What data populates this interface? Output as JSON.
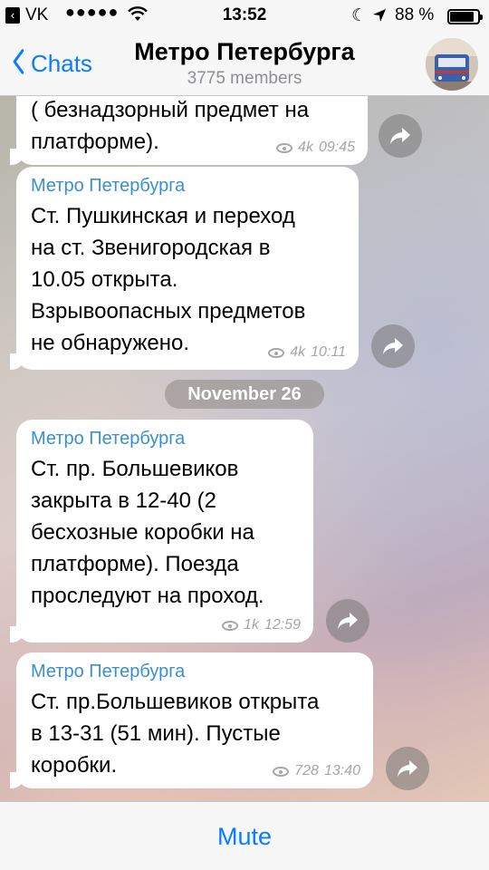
{
  "status_bar": {
    "carrier": "VK",
    "signal": "●●●●●",
    "time": "13:52",
    "battery_percent": "88 %",
    "battery_level": 0.88
  },
  "nav": {
    "back_label": "Chats",
    "title": "Метро Петербурга",
    "subtitle": "3775 members",
    "accent_color": "#0a7cff"
  },
  "messages": [
    {
      "author": "",
      "text": "( безнадзорный предмет на\nплатформе).",
      "views": "4k",
      "time": "09:45"
    },
    {
      "author": "Метро Петербурга",
      "text": "Ст. Пушкинская и переход\nна ст. Звенигородская в\n10.05 открыта.\nВзрывоопасных предметов\nне обнаружено.",
      "views": "4k",
      "time": "10:11"
    },
    {
      "author": "Метро Петербурга",
      "text": "Ст. пр. Большевиков\nзакрыта в 12-40 (2\nбесхозные коробки на\nплатформе). Поезда\nпроследуют на проход.",
      "views": "1k",
      "time": "12:59"
    },
    {
      "author": "Метро Петербурга",
      "text": "Ст. пр.Большевиков открыта\nв 13-31 (51 мин). Пустые\nкоробки.",
      "views": "728",
      "time": "13:40"
    }
  ],
  "date_separator": "November 26",
  "bottom": {
    "mute_label": "Mute"
  },
  "icons": [
    "back-icon",
    "wifi-icon",
    "moon-icon",
    "location-arrow-icon",
    "battery-icon",
    "chevron-left-icon",
    "avatar",
    "eye-icon",
    "share-icon"
  ]
}
